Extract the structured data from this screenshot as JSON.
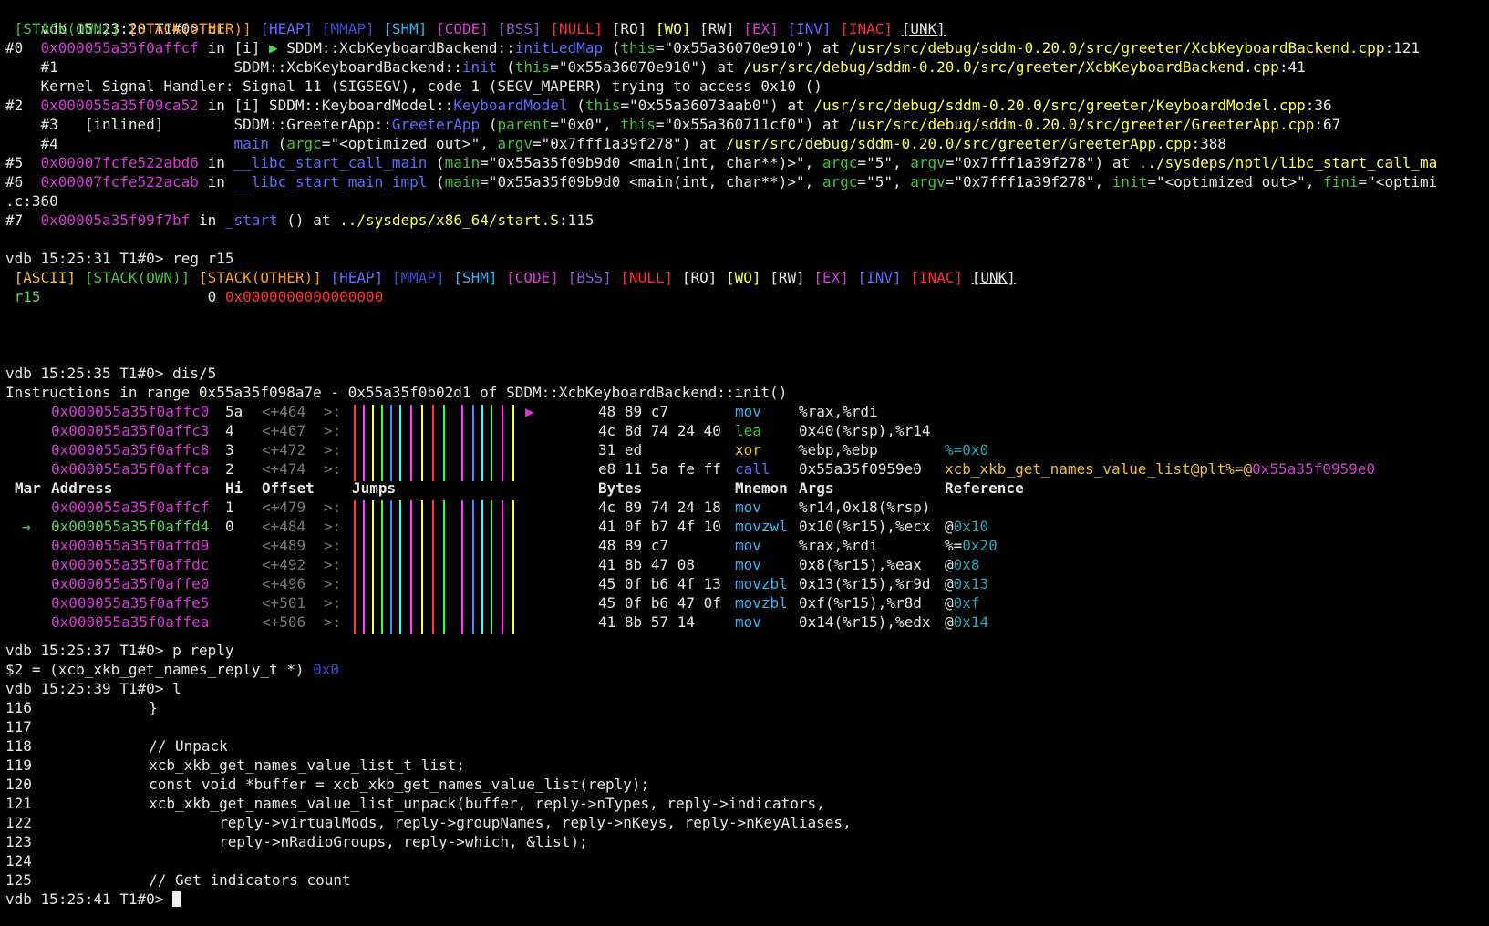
{
  "terminal": {
    "prompt_host": "vdb",
    "prompt_thread": "T1#0>",
    "prompts": {
      "bt": {
        "time": "15:23:20",
        "cmd": "bt"
      },
      "reg": {
        "time": "15:25:31",
        "cmd": "reg r15"
      },
      "dis": {
        "time": "15:25:35",
        "cmd": "dis/5"
      },
      "p": {
        "time": "15:25:37",
        "cmd": "p reply"
      },
      "l": {
        "time": "15:25:39",
        "cmd": "l"
      },
      "final": {
        "time": "15:25:41",
        "cmd": ""
      }
    },
    "legend_bt": [
      "[STACK(OWN)]",
      "[STACK(OTHER)]",
      "[HEAP]",
      "[MMAP]",
      "[SHM]",
      "[CODE]",
      "[BSS]",
      "[NULL]",
      "[RO]",
      "[WO]",
      "[RW]",
      "[EX]",
      "[INV]",
      "[INAC]",
      "[UNK]"
    ],
    "legend_reg": [
      "[ASCII]",
      "[STACK(OWN)]",
      "[STACK(OTHER)]",
      "[HEAP]",
      "[MMAP]",
      "[SHM]",
      "[CODE]",
      "[BSS]",
      "[NULL]",
      "[RO]",
      "[WO]",
      "[RW]",
      "[EX]",
      "[INV]",
      "[INAC]",
      "[UNK]"
    ],
    "backtrace": {
      "f0": {
        "num": "#0",
        "addr": "0x000055a35f0affcf",
        "in": "in",
        "flag": "[i]",
        "arrow": "▶",
        "ns": "SDDM::XcbKeyboardBackend::",
        "func": "initLedMap",
        "args": "(this=\"0x55a36070e910\")",
        "at": "at",
        "file": "/usr/src/debug/sddm-0.20.0/src/greeter/XcbKeyboardBackend.cpp",
        "line": ":121"
      },
      "f1": {
        "num": "#1",
        "ns": "SDDM::XcbKeyboardBackend::",
        "func": "init",
        "args": "(this=\"0x55a36070e910\")",
        "at": "at",
        "file": "/usr/src/debug/sddm-0.20.0/src/greeter/XcbKeyboardBackend.cpp",
        "line": ":41"
      },
      "signal": "Kernel Signal Handler: Signal 11 (SIGSEGV), code 1 (SEGV_MAPERR) trying to access 0x10 ()",
      "f2": {
        "num": "#2",
        "addr": "0x000055a35f09ca52",
        "in": "in",
        "flag": "[i]",
        "ns": "SDDM::KeyboardModel::",
        "func": "KeyboardModel",
        "args": "(this=\"0x55a36073aab0\")",
        "at": "at",
        "file": "/usr/src/debug/sddm-0.20.0/src/greeter/KeyboardModel.cpp",
        "line": ":36"
      },
      "f3": {
        "num": "#3",
        "flag": "[inlined]",
        "ns": "SDDM::GreeterApp::",
        "func": "GreeterApp",
        "args": "(parent=\"0x0\", this=\"0x55a360711cf0\")",
        "at": "at",
        "file": "/usr/src/debug/sddm-0.20.0/src/greeter/GreeterApp.cpp",
        "line": ":67"
      },
      "f4": {
        "num": "#4",
        "func": "main",
        "args": "(argc=\"<optimized out>\", argv=\"0x7fff1a39f278\")",
        "at": "at",
        "file": "/usr/src/debug/sddm-0.20.0/src/greeter/GreeterApp.cpp",
        "line": ":388"
      },
      "f5": {
        "num": "#5",
        "addr": "0x00007fcfe522abd6",
        "in": "in",
        "func": "__libc_start_call_main",
        "args": "(main=\"0x55a35f09b9d0 <main(int, char**)>\", argc=\"5\", argv=\"0x7fff1a39f278\")",
        "at": "at",
        "file": "../sysdeps/nptl/libc_start_call_ma"
      },
      "f6": {
        "num": "#6",
        "addr": "0x00007fcfe522acab",
        "in": "in",
        "func": "__libc_start_main_impl",
        "args": "(main=\"0x55a35f09b9d0 <main(int, char**)>\", argc=\"5\", argv=\"0x7fff1a39f278\", init=\"<optimized out>\", fini=\"<optimi",
        "cont": ".c:360"
      },
      "f7": {
        "num": "#7",
        "addr": "0x00005a35f09f7bf",
        "in": "in",
        "func": "_start",
        "args": "()",
        "at": "at",
        "file": "../sysdeps/x86_64/start.S",
        "line": ":115"
      }
    },
    "register": {
      "name": "r15",
      "dec": "0",
      "hex": "0x0000000000000000"
    },
    "disasm": {
      "range": "Instructions in range 0x55a35f098a7e - 0x55a35f0b02d1 of SDDM::XcbKeyboardBackend::init()",
      "headers": {
        "mar": "Mar",
        "address": "Address",
        "hi": "Hi",
        "offset": "Offset",
        "jumps": "Jumps",
        "bytes": "Bytes",
        "mnemonic": "Mnemon",
        "args": "Args",
        "reference": "Reference"
      },
      "pre_rows": [
        {
          "addr": "0x000055a35f0affc0",
          "hi": "5a",
          "offset": "<+464",
          "sep": ">:",
          "bytes": "48 89 c7",
          "mnem": "mov",
          "args": "%rax,%rdi",
          "ref": ""
        },
        {
          "addr": "0x000055a35f0affc3",
          "hi": "4",
          "offset": "<+467",
          "sep": ">:",
          "bytes": "4c 8d 74 24 40",
          "mnem": "lea",
          "args": "0x40(%rsp),%r14",
          "ref": ""
        },
        {
          "addr": "0x000055a35f0affc8",
          "hi": "3",
          "offset": "<+472",
          "sep": ">:",
          "bytes": "31 ed",
          "mnem": "xor",
          "args": "%ebp,%ebp",
          "ref": "%=0x0"
        },
        {
          "addr": "0x000055a35f0affca",
          "hi": "2",
          "offset": "<+474",
          "sep": ">:",
          "bytes": "e8 11 5a fe ff",
          "mnem": "call",
          "args": "0x55a35f0959e0",
          "ref": "xcb_xkb_get_names_value_list@plt%=@0x55a35f0959e0"
        }
      ],
      "rows": [
        {
          "mar": "",
          "addr": "0x000055a35f0affcf",
          "hi": "1",
          "offset": "<+479",
          "sep": ">:",
          "bytes": "4c 89 74 24 18",
          "mnem": "mov",
          "args": "%r14,0x18(%rsp)",
          "ref": ""
        },
        {
          "mar": "→",
          "addr": "0x000055a35f0affd4",
          "hi": "0",
          "offset": "<+484",
          "sep": ">:",
          "bytes": "41 0f b7 4f 10",
          "mnem": "movzwl",
          "args": "0x10(%r15),%ecx",
          "ref": "@0x10"
        },
        {
          "mar": "",
          "addr": "0x000055a35f0affd9",
          "hi": "",
          "offset": "<+489",
          "sep": ">:",
          "bytes": "48 89 c7",
          "mnem": "mov",
          "args": "%rax,%rdi",
          "ref": "%=0x20"
        },
        {
          "mar": "",
          "addr": "0x000055a35f0affdc",
          "hi": "",
          "offset": "<+492",
          "sep": ">:",
          "bytes": "41 8b 47 08",
          "mnem": "mov",
          "args": "0x8(%r15),%eax",
          "ref": "@0x8"
        },
        {
          "mar": "",
          "addr": "0x000055a35f0affe0",
          "hi": "",
          "offset": "<+496",
          "sep": ">:",
          "bytes": "45 0f b6 4f 13",
          "mnem": "movzbl",
          "args": "0x13(%r15),%r9d",
          "ref": "@0x13"
        },
        {
          "mar": "",
          "addr": "0x000055a35f0affe5",
          "hi": "",
          "offset": "<+501",
          "sep": ">:",
          "bytes": "45 0f b6 47 0f",
          "mnem": "movzbl",
          "args": "0xf(%r15),%r8d",
          "ref": "@0xf"
        },
        {
          "mar": "",
          "addr": "0x000055a35f0affea",
          "hi": "",
          "offset": "<+506",
          "sep": ">:",
          "bytes": "41 8b 57 14",
          "mnem": "mov",
          "args": "0x14(%r15),%edx",
          "ref": "@0x14"
        }
      ]
    },
    "print_result": {
      "prefix": "$2 = (xcb_xkb_get_names_reply_t *)",
      "value": "0x0"
    },
    "listing": [
      {
        "n": "116",
        "code": "        }"
      },
      {
        "n": "117",
        "code": ""
      },
      {
        "n": "118",
        "code": "        // Unpack"
      },
      {
        "n": "119",
        "code": "        xcb_xkb_get_names_value_list_t list;"
      },
      {
        "n": "120",
        "code": "        const void *buffer = xcb_xkb_get_names_value_list(reply);"
      },
      {
        "n": "121",
        "code": "        xcb_xkb_get_names_value_list_unpack(buffer, reply->nTypes, reply->indicators,"
      },
      {
        "n": "122",
        "code": "                reply->virtualMods, reply->groupNames, reply->nKeys, reply->nKeyAliases,"
      },
      {
        "n": "123",
        "code": "                reply->nRadioGroups, reply->which, &list);"
      },
      {
        "n": "124",
        "code": ""
      },
      {
        "n": "125",
        "code": "        // Get indicators count"
      }
    ]
  }
}
